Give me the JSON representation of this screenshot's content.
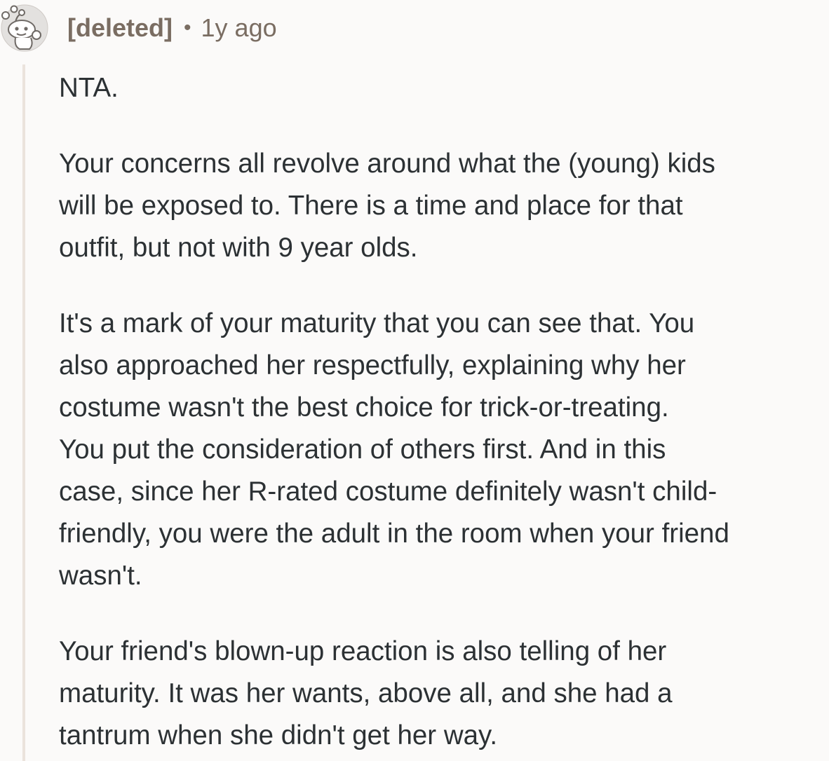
{
  "comment": {
    "author": "[deleted]",
    "separator": "•",
    "age": "1y ago",
    "avatar_icon": "deleted-user-snoo-icon",
    "colors": {
      "background": "#fbfaf9",
      "meta_text": "#7a6d62",
      "body_text": "#2c3134",
      "thread_line": "#ebe3dc"
    },
    "paragraphs": [
      "NTA.",
      "Your concerns all revolve around what the (young) kids\nwill be exposed to. There is a time and place for that\noutfit, but not with 9 year olds.",
      "It's a mark of your maturity that you can see that. You\nalso approached her respectfully, explaining why her\ncostume wasn't the best choice for trick-or-treating.\nYou put the consideration of others first. And in this\ncase, since her R-rated costume definitely wasn't child-\nfriendly, you were the adult in the room when your friend\nwasn't.",
      "Your friend's blown-up reaction is also telling of her\nmaturity. It was her wants, above all, and she had a\ntantrum when she didn't get her way."
    ]
  }
}
